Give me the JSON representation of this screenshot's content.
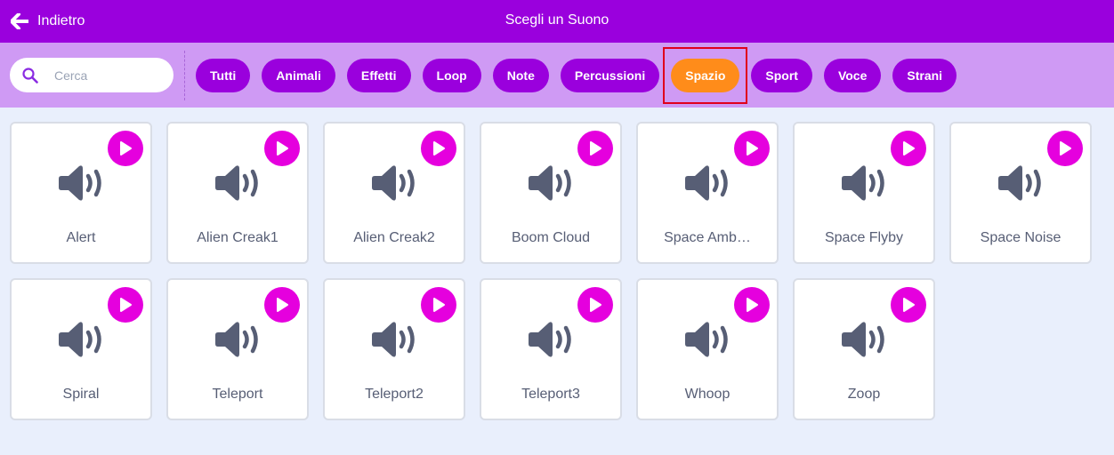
{
  "header": {
    "back_label": "Indietro",
    "title": "Scegli un Suono"
  },
  "search": {
    "placeholder": "Cerca",
    "value": ""
  },
  "tags": [
    {
      "label": "Tutti",
      "active": false
    },
    {
      "label": "Animali",
      "active": false
    },
    {
      "label": "Effetti",
      "active": false
    },
    {
      "label": "Loop",
      "active": false
    },
    {
      "label": "Note",
      "active": false
    },
    {
      "label": "Percussioni",
      "active": false
    },
    {
      "label": "Spazio",
      "active": true
    },
    {
      "label": "Sport",
      "active": false
    },
    {
      "label": "Voce",
      "active": false
    },
    {
      "label": "Strani",
      "active": false
    }
  ],
  "sounds": [
    "Alert",
    "Alien Creak1",
    "Alien Creak2",
    "Boom Cloud",
    "Space Amb…",
    "Space Flyby",
    "Space Noise",
    "Spiral",
    "Teleport",
    "Teleport2",
    "Teleport3",
    "Whoop",
    "Zoop"
  ],
  "colors": {
    "header": "#9a00dd",
    "filterbar": "#cf9af4",
    "tag": "#9a00dd",
    "tag_active": "#ff8c1a",
    "play_button": "#e500de",
    "speaker_icon": "#575e75",
    "highlight": "#e0001b",
    "background": "#e9effc"
  },
  "icons": {
    "back": "arrow-left-icon",
    "search": "search-icon",
    "play": "play-icon",
    "sound": "speaker-icon"
  }
}
